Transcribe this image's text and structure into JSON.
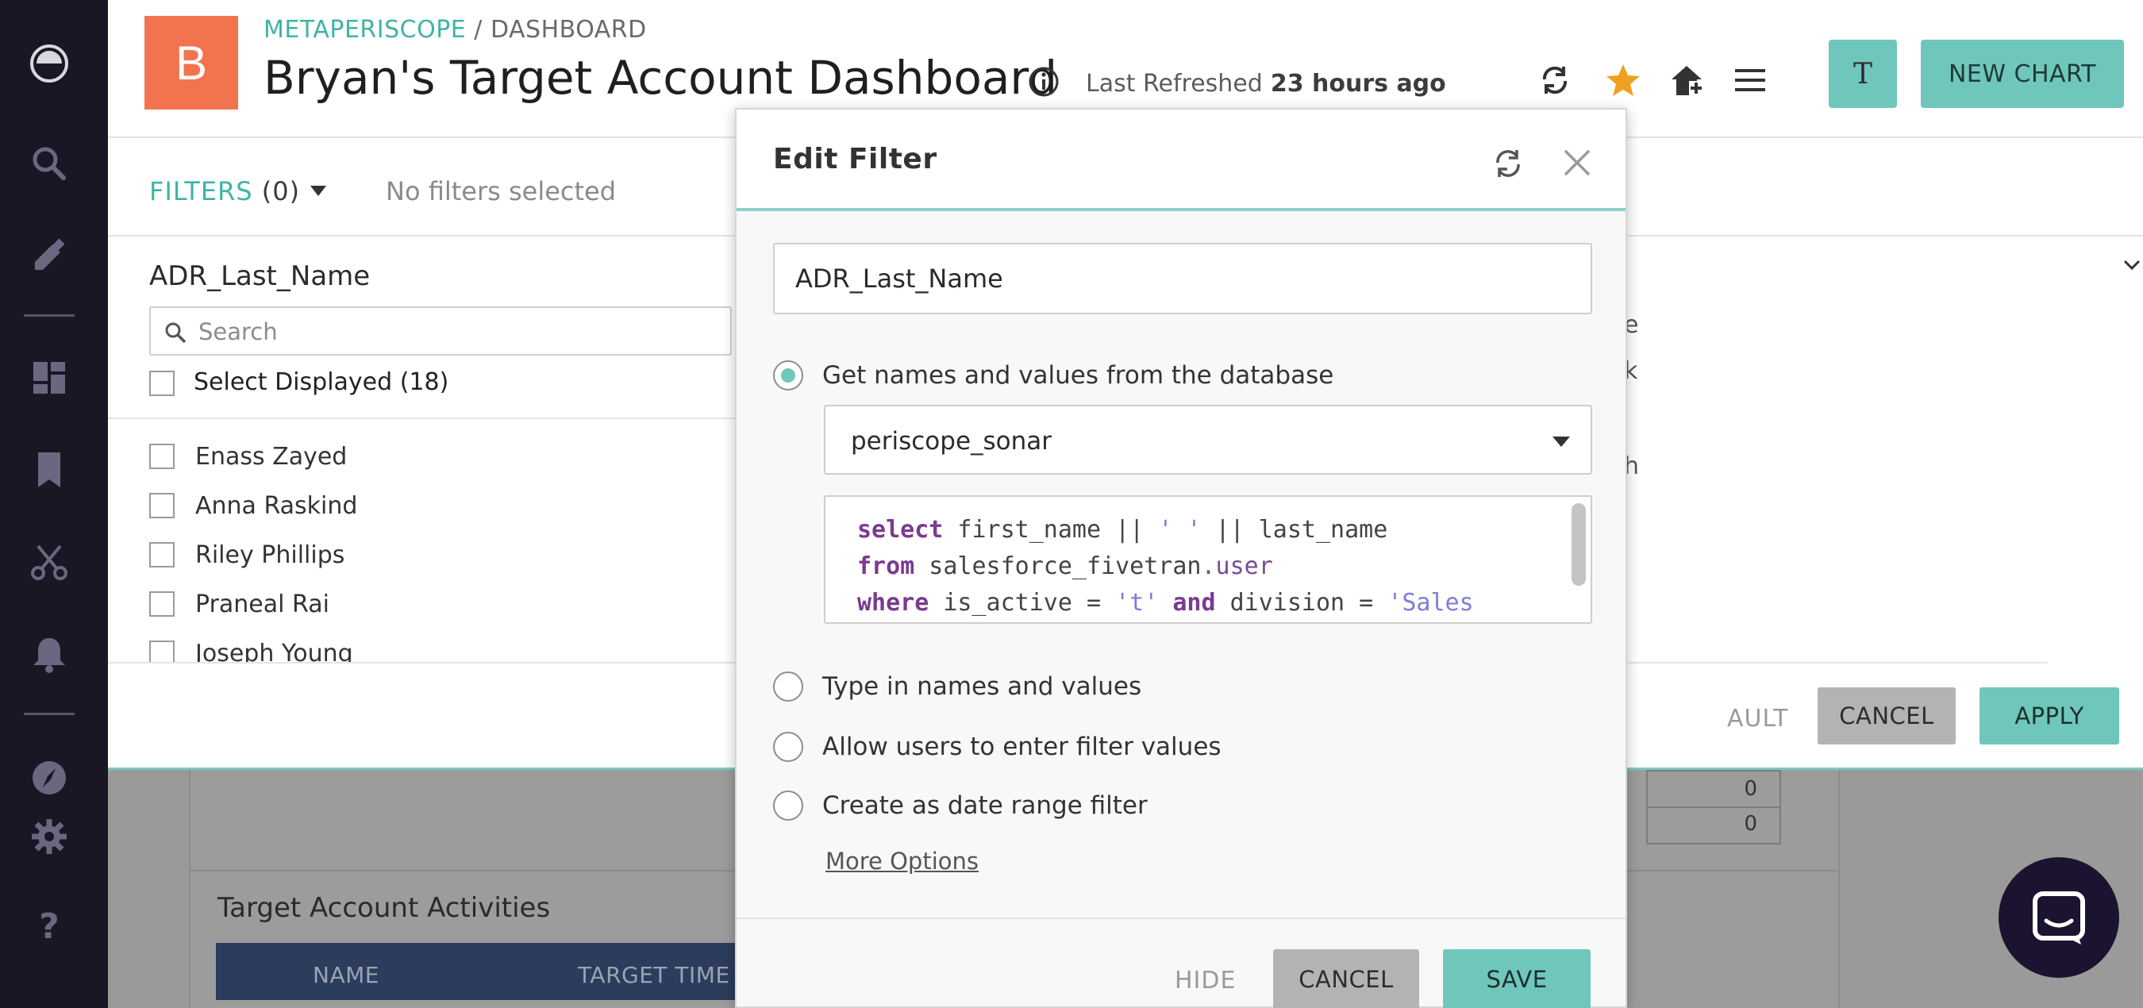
{
  "sidebar": {
    "icons": [
      "logo-icon",
      "search-icon",
      "edit-icon",
      "dashboards-icon",
      "bookmark-icon",
      "scissors-icon",
      "bell-icon",
      "compass-icon",
      "settings-icon",
      "help-icon"
    ]
  },
  "header": {
    "avatar_letter": "B",
    "breadcrumb_root": "METAPERISCOPE",
    "breadcrumb_sep": " / ",
    "breadcrumb_current": "DASHBOARD",
    "title": "Bryan's Target Account Dashboard",
    "last_refreshed_label": "Last Refreshed",
    "last_refreshed_value": "23 hours ago",
    "user_initial": "T",
    "new_chart_label": "NEW CHART"
  },
  "filters": {
    "label": "FILTERS",
    "count": "(0)",
    "status": "No filters selected",
    "column_title": "ADR_Last_Name",
    "search_placeholder": "Search",
    "select_displayed": "Select Displayed (18)",
    "names": [
      "Enass Zayed",
      "Anna Raskind",
      "Riley Phillips",
      "Praneal Rai",
      "Joseph Young"
    ],
    "partial_right": [
      "e",
      "k",
      "h"
    ],
    "default_partial": "AULT",
    "cancel_label": "CANCEL",
    "apply_label": "APPLY"
  },
  "background": {
    "card_title": "Target Account Activities",
    "table_headers": [
      "NAME",
      "TARGET TIME"
    ],
    "cells": [
      "0",
      "0"
    ]
  },
  "modal": {
    "title": "Edit Filter",
    "name_value": "ADR_Last_Name",
    "options": [
      {
        "label": "Get names and values from the database",
        "selected": true
      },
      {
        "label": "Type in names and values",
        "selected": false
      },
      {
        "label": "Allow users to enter filter values",
        "selected": false
      },
      {
        "label": "Create as date range filter",
        "selected": false
      }
    ],
    "database": "periscope_sonar",
    "sql": {
      "l1_kw": "select",
      "l1_rest": " first_name || ",
      "l1_str": "' '",
      "l1_end": " || last_name",
      "l2_kw": "from",
      "l2_rest": " salesforce_fivetran",
      "l2_tbl": ".user",
      "l3_kw": "where",
      "l3_rest": " is_active = ",
      "l3_str": "'t'",
      "l3_kw2": " and",
      "l3_rest2": " division = ",
      "l3_str2": "'Sales"
    },
    "more_options": "More Options",
    "hide_label": "HIDE",
    "cancel_label": "CANCEL",
    "save_label": "SAVE"
  },
  "colors": {
    "accent": "#6fc7bb",
    "sidebar_bg": "#1a1624",
    "avatar_bg": "#f2744e",
    "star": "#f0a020"
  }
}
